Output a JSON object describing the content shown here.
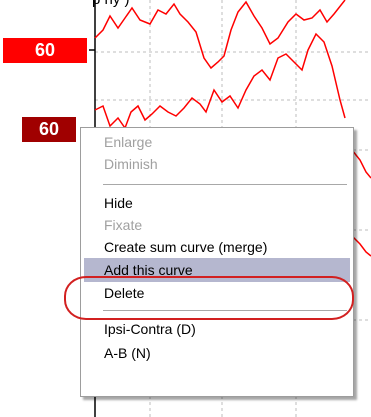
{
  "plot": {
    "cut_text": "p     ny )",
    "level_labels": [
      "60",
      "60"
    ],
    "curve_color": "#ff0000",
    "badge_colors": [
      "#ff0000",
      "#a00000"
    ]
  },
  "context_menu": {
    "items": [
      {
        "label": "Enlarge",
        "enabled": false
      },
      {
        "label": "Diminish",
        "enabled": false
      },
      {
        "label": "Hide",
        "enabled": true
      },
      {
        "label": "Fixate",
        "enabled": false
      },
      {
        "label": "Create sum curve (merge)",
        "enabled": true
      },
      {
        "label": "Add this curve",
        "enabled": true,
        "selected": true
      },
      {
        "label": "Delete",
        "enabled": true
      },
      {
        "label": "Ipsi-Contra (D)",
        "enabled": true
      },
      {
        "label": "A-B (N)",
        "enabled": true
      }
    ],
    "highlight_color": "#d22020",
    "selection_color": "#b5b7cf"
  }
}
